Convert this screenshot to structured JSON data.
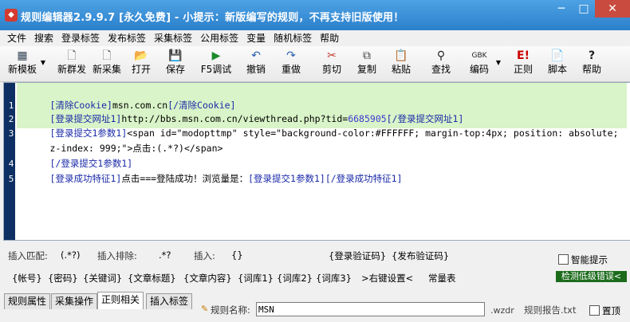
{
  "window": {
    "title": "规则编辑器2.9.9.7 [永久免费] - 小提示：新版编写的规则，不再支持旧版使用！",
    "minimize": "─",
    "maximize": "□",
    "close": "✕"
  },
  "menu": [
    "文件",
    "搜索",
    "登录标签",
    "发布标签",
    "采集标签",
    "公用标签",
    "变量",
    "随机标签",
    "帮助"
  ],
  "toolbar": {
    "new_template": "新模板",
    "new_post": "新群发",
    "new_collect": "新采集",
    "open": "打开",
    "save": "保存",
    "debug": "F5调试",
    "undo": "撤销",
    "redo": "重做",
    "cut": "剪切",
    "copy": "复制",
    "paste": "粘贴",
    "find": "查找",
    "encoding": "编码",
    "encoding_badge": "GBK",
    "regex": "正则",
    "script": "脚本",
    "help": "帮助"
  },
  "editor": {
    "lines": [
      "1",
      "2",
      "3",
      "4",
      "5"
    ],
    "l1": {
      "open": "[清除Cookie]",
      "text": "msn.com.cn",
      "close": "[/清除Cookie]"
    },
    "l2": {
      "open": "[登录提交网址1]",
      "url": "http://bbs.msn.com.cn/viewthread.php?tid=",
      "num": "6685905",
      "close": "[/登录提交网址1]"
    },
    "l3": {
      "open": "[登录提交1参数1]",
      "a": "<span id=\"modopttmp\" style=\"background-color:#FFFFFF; margin-top:4px; position: absolute;",
      "b": "z-index: 999;\">",
      "c": "点击:(.*?)",
      "d": "</span>"
    },
    "l4": {
      "text": "[/登录提交1参数1]"
    },
    "l5": {
      "open": "[登录成功特征1]",
      "text": "点击===登陆成功！浏览量是：",
      "ref": "[登录提交1参数1]",
      "close": "[/登录成功特征1]"
    }
  },
  "bottom": {
    "match_label": "插入匹配:",
    "match_value": "(.*?)",
    "exclude_label": "插入排除:",
    "exclude_value": ".*?",
    "insert_label": "插入:",
    "insert_value": "{}",
    "captcha_login": "{登录验证码}",
    "captcha_post": "{发布验证码}",
    "smart_hint": "智能提示",
    "check_errors": "检测低级错误<",
    "tags": [
      "{帐号}",
      "{密码}",
      "{关键词}",
      "{文章标题}",
      "{文章内容}",
      "{词库1}",
      "{词库2}",
      "{词库3}",
      ">右键设置<",
      "常量表"
    ]
  },
  "tabs": [
    "规则属性",
    "采集操作",
    "正则相关",
    "插入标签"
  ],
  "status": {
    "name_label": "规则名称:",
    "name_value": "MSN",
    "ext": ".wzdr",
    "report": "规则报告.txt",
    "pin": "置顶"
  }
}
